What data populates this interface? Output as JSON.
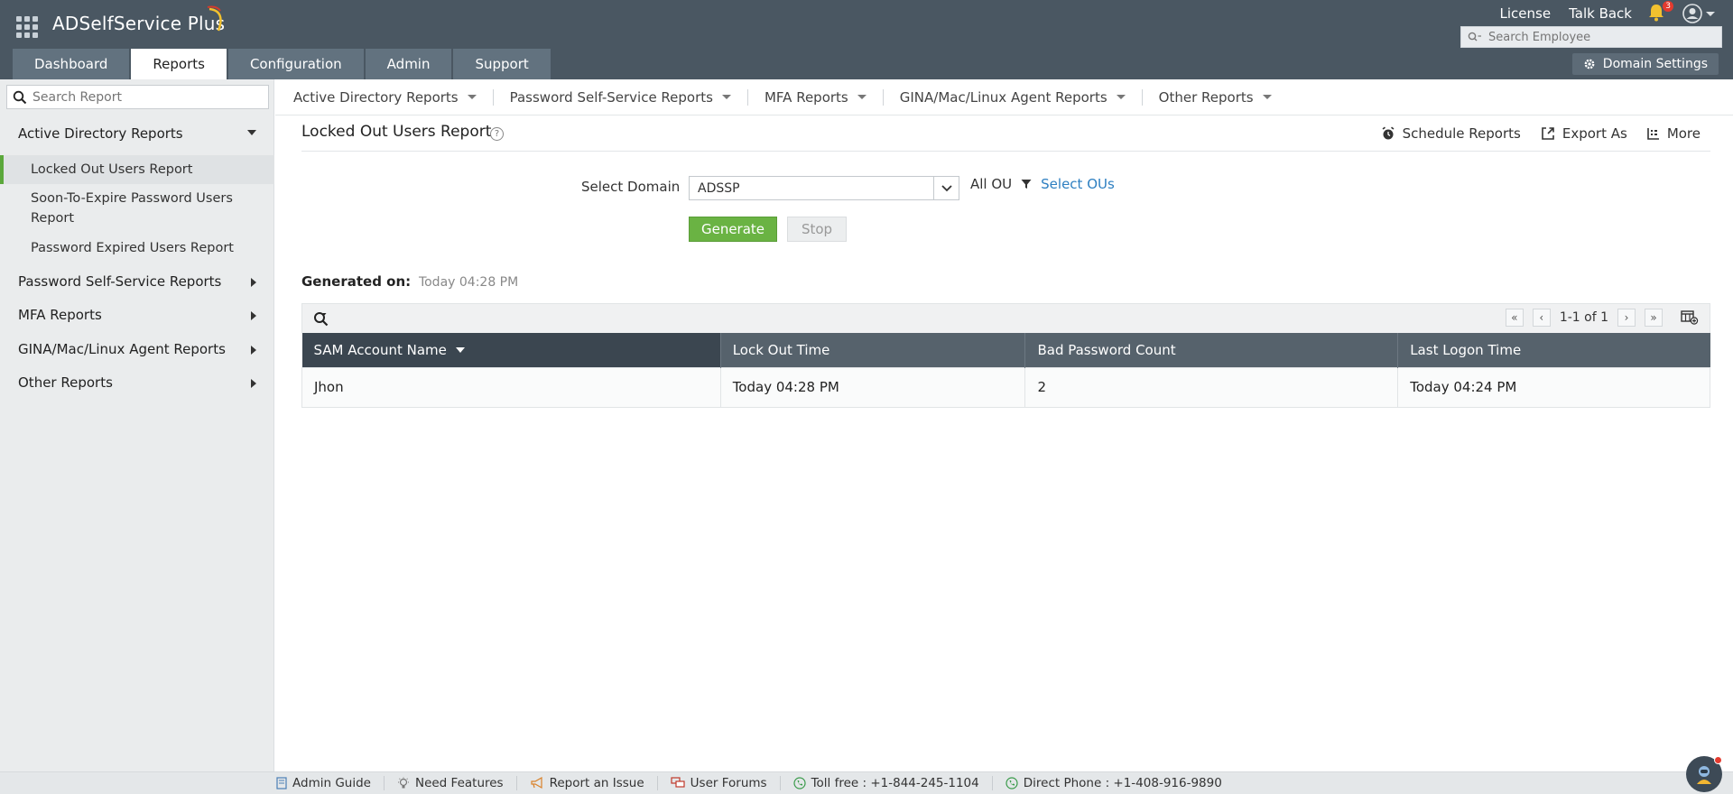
{
  "app": {
    "name": "ADSelfService Plus",
    "top_links": [
      "License",
      "Talk Back"
    ],
    "notification_count": "3",
    "search_placeholder": "Search Employee",
    "domain_settings_label": "Domain Settings"
  },
  "tabs": [
    {
      "label": "Dashboard",
      "active": false
    },
    {
      "label": "Reports",
      "active": true
    },
    {
      "label": "Configuration",
      "active": false
    },
    {
      "label": "Admin",
      "active": false
    },
    {
      "label": "Support",
      "active": false
    }
  ],
  "sidebar": {
    "search_placeholder": "Search Report",
    "categories": [
      {
        "label": "Active Directory Reports",
        "expanded": true
      },
      {
        "label": "Password Self-Service Reports",
        "expanded": false
      },
      {
        "label": "MFA Reports",
        "expanded": false
      },
      {
        "label": "GINA/Mac/Linux Agent Reports",
        "expanded": false
      },
      {
        "label": "Other Reports",
        "expanded": false
      }
    ],
    "sub_items": [
      {
        "label": "Locked Out Users Report",
        "active": true
      },
      {
        "label": "Soon-To-Expire Password Users Report",
        "active": false
      },
      {
        "label": "Password Expired Users Report",
        "active": false
      }
    ]
  },
  "subnav": [
    "Active Directory Reports",
    "Password Self-Service Reports",
    "MFA Reports",
    "GINA/Mac/Linux Agent Reports",
    "Other Reports"
  ],
  "report": {
    "title": "Locked Out Users Report",
    "help": "?",
    "actions": [
      "Schedule Reports",
      "Export As",
      "More"
    ],
    "domain_label": "Select Domain",
    "domain_value": "ADSSP",
    "all_ou": "All OU",
    "select_ous": "Select OUs",
    "generate_label": "Generate",
    "stop_label": "Stop",
    "generated_on_label": "Generated on:",
    "generated_on_value": "Today 04:28 PM",
    "pager_text": "1-1 of 1",
    "columns": [
      "SAM Account Name",
      "Lock Out Time",
      "Bad Password Count",
      "Last Logon Time"
    ],
    "rows": [
      [
        "Jhon",
        "Today 04:28 PM",
        "2",
        "Today 04:24 PM"
      ]
    ]
  },
  "footer": {
    "items": [
      {
        "label": "Admin Guide",
        "icon": "book-icon"
      },
      {
        "label": "Need Features",
        "icon": "bulb-icon"
      },
      {
        "label": "Report an Issue",
        "icon": "megaphone-icon"
      },
      {
        "label": "User Forums",
        "icon": "chat-icon"
      },
      {
        "label": "Toll free : +1-844-245-1104",
        "icon": "phone-icon"
      },
      {
        "label": "Direct Phone : +1-408-916-9890",
        "icon": "phone-icon"
      }
    ]
  },
  "colors": {
    "header_bg": "#4a5762",
    "accent_green": "#6ab343",
    "link_blue": "#2d7fc1",
    "notification_red": "#e43b2f"
  }
}
